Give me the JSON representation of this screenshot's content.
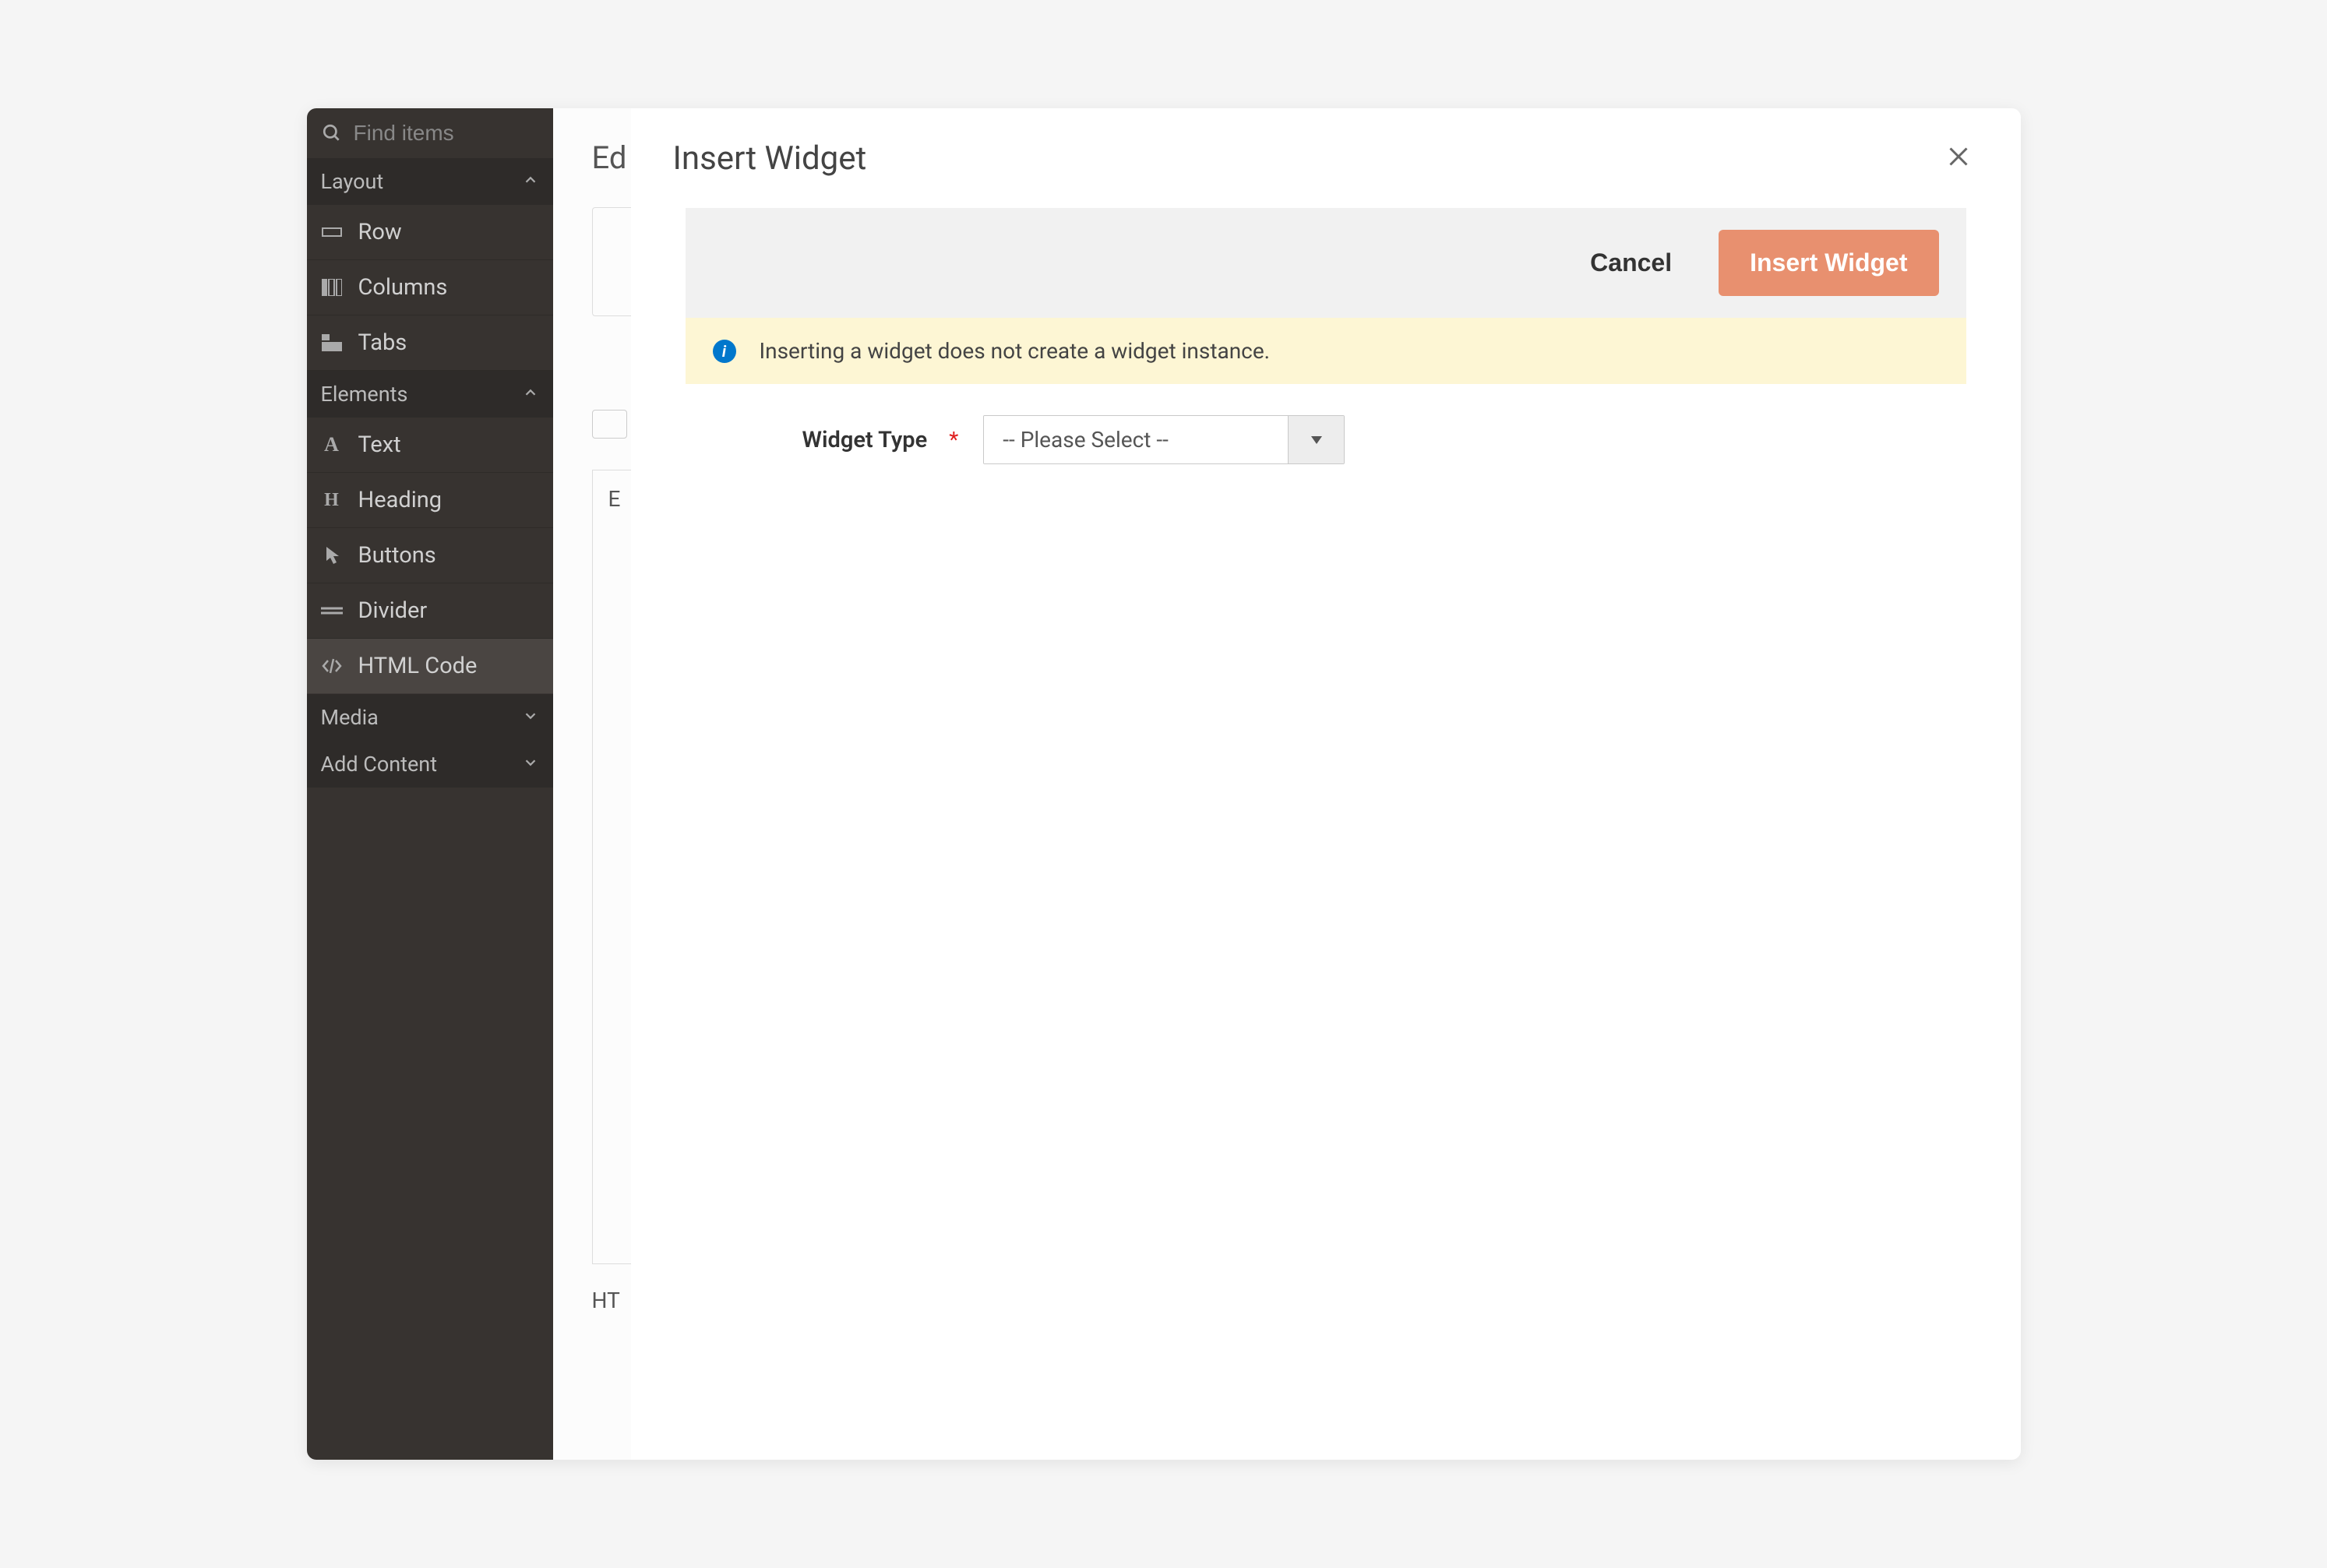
{
  "sidebar": {
    "search_placeholder": "Find items",
    "sections": [
      {
        "label": "Layout",
        "expanded": true,
        "items": [
          {
            "label": "Row",
            "icon": "row-icon"
          },
          {
            "label": "Columns",
            "icon": "columns-icon"
          },
          {
            "label": "Tabs",
            "icon": "tabs-icon"
          }
        ]
      },
      {
        "label": "Elements",
        "expanded": true,
        "items": [
          {
            "label": "Text",
            "icon": "text-icon"
          },
          {
            "label": "Heading",
            "icon": "heading-icon"
          },
          {
            "label": "Buttons",
            "icon": "buttons-icon"
          },
          {
            "label": "Divider",
            "icon": "divider-icon"
          },
          {
            "label": "HTML Code",
            "icon": "code-icon",
            "active": true
          }
        ]
      },
      {
        "label": "Media",
        "expanded": false
      },
      {
        "label": "Add Content",
        "expanded": false
      }
    ]
  },
  "main": {
    "title_partial": "Ed",
    "textarea_placeholder": "E",
    "bottom_label": "HT"
  },
  "modal": {
    "title": "Insert Widget",
    "cancel_label": "Cancel",
    "submit_label": "Insert Widget",
    "info_text": "Inserting a widget does not create a widget instance.",
    "form": {
      "widget_type_label": "Widget Type",
      "widget_type_value": "-- Please Select --"
    }
  }
}
